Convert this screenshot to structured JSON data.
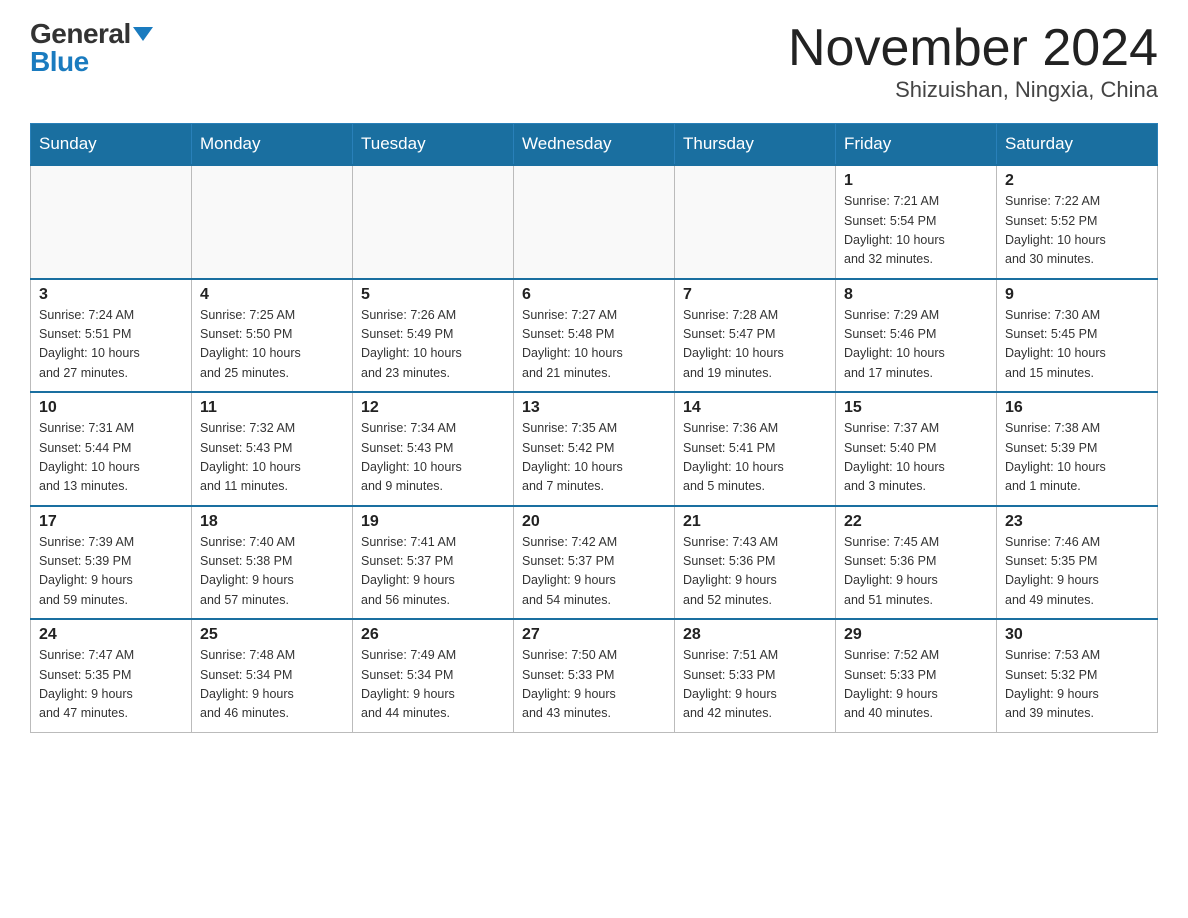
{
  "header": {
    "logo_general": "General",
    "logo_blue": "Blue",
    "month_title": "November 2024",
    "location": "Shizuishan, Ningxia, China"
  },
  "weekdays": [
    "Sunday",
    "Monday",
    "Tuesday",
    "Wednesday",
    "Thursday",
    "Friday",
    "Saturday"
  ],
  "weeks": [
    [
      {
        "day": "",
        "info": ""
      },
      {
        "day": "",
        "info": ""
      },
      {
        "day": "",
        "info": ""
      },
      {
        "day": "",
        "info": ""
      },
      {
        "day": "",
        "info": ""
      },
      {
        "day": "1",
        "info": "Sunrise: 7:21 AM\nSunset: 5:54 PM\nDaylight: 10 hours\nand 32 minutes."
      },
      {
        "day": "2",
        "info": "Sunrise: 7:22 AM\nSunset: 5:52 PM\nDaylight: 10 hours\nand 30 minutes."
      }
    ],
    [
      {
        "day": "3",
        "info": "Sunrise: 7:24 AM\nSunset: 5:51 PM\nDaylight: 10 hours\nand 27 minutes."
      },
      {
        "day": "4",
        "info": "Sunrise: 7:25 AM\nSunset: 5:50 PM\nDaylight: 10 hours\nand 25 minutes."
      },
      {
        "day": "5",
        "info": "Sunrise: 7:26 AM\nSunset: 5:49 PM\nDaylight: 10 hours\nand 23 minutes."
      },
      {
        "day": "6",
        "info": "Sunrise: 7:27 AM\nSunset: 5:48 PM\nDaylight: 10 hours\nand 21 minutes."
      },
      {
        "day": "7",
        "info": "Sunrise: 7:28 AM\nSunset: 5:47 PM\nDaylight: 10 hours\nand 19 minutes."
      },
      {
        "day": "8",
        "info": "Sunrise: 7:29 AM\nSunset: 5:46 PM\nDaylight: 10 hours\nand 17 minutes."
      },
      {
        "day": "9",
        "info": "Sunrise: 7:30 AM\nSunset: 5:45 PM\nDaylight: 10 hours\nand 15 minutes."
      }
    ],
    [
      {
        "day": "10",
        "info": "Sunrise: 7:31 AM\nSunset: 5:44 PM\nDaylight: 10 hours\nand 13 minutes."
      },
      {
        "day": "11",
        "info": "Sunrise: 7:32 AM\nSunset: 5:43 PM\nDaylight: 10 hours\nand 11 minutes."
      },
      {
        "day": "12",
        "info": "Sunrise: 7:34 AM\nSunset: 5:43 PM\nDaylight: 10 hours\nand 9 minutes."
      },
      {
        "day": "13",
        "info": "Sunrise: 7:35 AM\nSunset: 5:42 PM\nDaylight: 10 hours\nand 7 minutes."
      },
      {
        "day": "14",
        "info": "Sunrise: 7:36 AM\nSunset: 5:41 PM\nDaylight: 10 hours\nand 5 minutes."
      },
      {
        "day": "15",
        "info": "Sunrise: 7:37 AM\nSunset: 5:40 PM\nDaylight: 10 hours\nand 3 minutes."
      },
      {
        "day": "16",
        "info": "Sunrise: 7:38 AM\nSunset: 5:39 PM\nDaylight: 10 hours\nand 1 minute."
      }
    ],
    [
      {
        "day": "17",
        "info": "Sunrise: 7:39 AM\nSunset: 5:39 PM\nDaylight: 9 hours\nand 59 minutes."
      },
      {
        "day": "18",
        "info": "Sunrise: 7:40 AM\nSunset: 5:38 PM\nDaylight: 9 hours\nand 57 minutes."
      },
      {
        "day": "19",
        "info": "Sunrise: 7:41 AM\nSunset: 5:37 PM\nDaylight: 9 hours\nand 56 minutes."
      },
      {
        "day": "20",
        "info": "Sunrise: 7:42 AM\nSunset: 5:37 PM\nDaylight: 9 hours\nand 54 minutes."
      },
      {
        "day": "21",
        "info": "Sunrise: 7:43 AM\nSunset: 5:36 PM\nDaylight: 9 hours\nand 52 minutes."
      },
      {
        "day": "22",
        "info": "Sunrise: 7:45 AM\nSunset: 5:36 PM\nDaylight: 9 hours\nand 51 minutes."
      },
      {
        "day": "23",
        "info": "Sunrise: 7:46 AM\nSunset: 5:35 PM\nDaylight: 9 hours\nand 49 minutes."
      }
    ],
    [
      {
        "day": "24",
        "info": "Sunrise: 7:47 AM\nSunset: 5:35 PM\nDaylight: 9 hours\nand 47 minutes."
      },
      {
        "day": "25",
        "info": "Sunrise: 7:48 AM\nSunset: 5:34 PM\nDaylight: 9 hours\nand 46 minutes."
      },
      {
        "day": "26",
        "info": "Sunrise: 7:49 AM\nSunset: 5:34 PM\nDaylight: 9 hours\nand 44 minutes."
      },
      {
        "day": "27",
        "info": "Sunrise: 7:50 AM\nSunset: 5:33 PM\nDaylight: 9 hours\nand 43 minutes."
      },
      {
        "day": "28",
        "info": "Sunrise: 7:51 AM\nSunset: 5:33 PM\nDaylight: 9 hours\nand 42 minutes."
      },
      {
        "day": "29",
        "info": "Sunrise: 7:52 AM\nSunset: 5:33 PM\nDaylight: 9 hours\nand 40 minutes."
      },
      {
        "day": "30",
        "info": "Sunrise: 7:53 AM\nSunset: 5:32 PM\nDaylight: 9 hours\nand 39 minutes."
      }
    ]
  ]
}
